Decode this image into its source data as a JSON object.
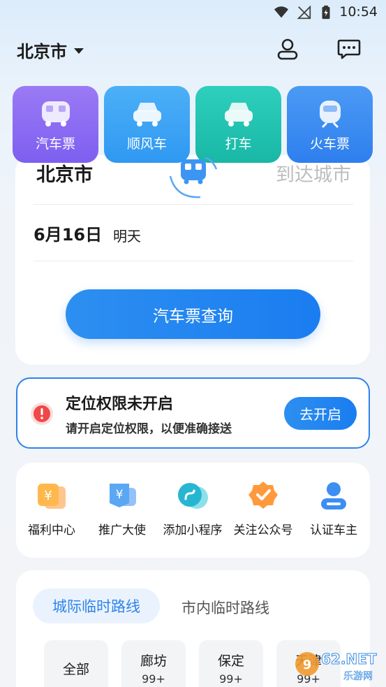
{
  "status_bar": {
    "time": "10:54"
  },
  "header": {
    "city": "北京市"
  },
  "transport_tabs": [
    {
      "label": "汽车票",
      "color": "#8a6cf0"
    },
    {
      "label": "顺风车",
      "color": "#3ea2f5"
    },
    {
      "label": "打车",
      "color": "#22c2b1"
    },
    {
      "label": "火车票",
      "color": "#3b8cf1"
    }
  ],
  "search": {
    "from_city": "北京市",
    "to_city_placeholder": "到达城市",
    "date": "6月16日",
    "date_note": "明天",
    "query_label": "汽车票查询"
  },
  "location_banner": {
    "title": "定位权限未开启",
    "subtitle": "请开启定位权限，以便准确接送",
    "button": "去开启"
  },
  "quick_actions": [
    {
      "label": "福利中心",
      "icon": "welfare-icon"
    },
    {
      "label": "推广大使",
      "icon": "promoter-icon"
    },
    {
      "label": "添加小程序",
      "icon": "mini-program-icon"
    },
    {
      "label": "关注公众号",
      "icon": "official-account-icon"
    },
    {
      "label": "认证车主",
      "icon": "driver-verify-icon"
    }
  ],
  "routes": {
    "tabs": [
      "城际临时路线",
      "市内临时路线"
    ],
    "chips": [
      {
        "name": "全部",
        "count": ""
      },
      {
        "name": "廊坊",
        "count": "99+"
      },
      {
        "name": "保定",
        "count": "99+"
      },
      {
        "name": "天津",
        "count": "99+"
      }
    ]
  },
  "watermark": {
    "text": "962.NET",
    "sub": "乐游网"
  },
  "colors": {
    "accent": "#2f83e9",
    "alert": "#f04848"
  }
}
